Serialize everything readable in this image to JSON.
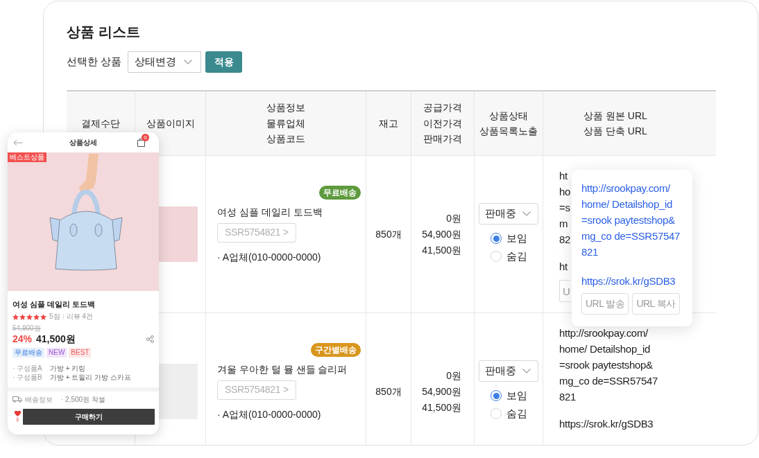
{
  "page": {
    "title": "상품 리스트"
  },
  "bulk_action": {
    "label": "선택한 상품",
    "select": "상태변경",
    "apply_button": "적용"
  },
  "table": {
    "columns": [
      {
        "lines": [
          "결제수단"
        ]
      },
      {
        "lines": [
          "상품이미지"
        ]
      },
      {
        "lines": [
          "상품정보",
          "물류업체",
          "상품코드"
        ]
      },
      {
        "lines": [
          "재고"
        ]
      },
      {
        "lines": [
          "공급가격",
          "이전가격",
          "판매가격"
        ]
      },
      {
        "lines": [
          "상품상태",
          "상품목록노출"
        ]
      },
      {
        "lines": [
          "상품 원본 URL",
          "상품 단축 URL"
        ]
      }
    ],
    "rows": [
      {
        "shipping_badge": {
          "label": "무료배송",
          "color": "#5e9a3e"
        },
        "name": "여성 심플 데일리 토드백",
        "code": "SSR5754821 >",
        "vendor": "· A업체(010-0000-0000)",
        "stock": "850개",
        "prices": [
          "0원",
          "54,900원",
          "41,500원"
        ],
        "status": "판매중",
        "visibility": [
          {
            "label": "보임",
            "selected": true
          },
          {
            "label": "숨김",
            "selected": false
          }
        ],
        "original_url": [
          "ht",
          "ho",
          "=s",
          "m",
          "82"
        ],
        "short_url": "ht",
        "buttons": [
          "U"
        ]
      },
      {
        "shipping_badge": {
          "label": "구간별배송",
          "color": "#d9961d"
        },
        "name": "겨울 우아한 털 뮬 샌들 슬리퍼",
        "code": "SSR5754821 >",
        "vendor": "· A업체(010-0000-0000)",
        "stock": "850개",
        "prices": [
          "0원",
          "54,900원",
          "41,500원"
        ],
        "status": "판매중",
        "visibility": [
          {
            "label": "보임",
            "selected": true
          },
          {
            "label": "숨김",
            "selected": false
          }
        ],
        "original_url": [
          "http://srookpay.com/",
          "home/ Detailshop_id",
          "=srook paytestshop&",
          "mg_co de=SSR57547",
          "821"
        ],
        "short_url": "https://srok.kr/gSDB3"
      }
    ]
  },
  "url_popover": {
    "original_url": [
      "http://srookpay.com/",
      "home/ Detailshop_id",
      "=srook paytestshop&",
      "mg_co de=SSR57547",
      "821"
    ],
    "short_url": "https://srok.kr/gSDB3",
    "buttons": [
      "URL 발송",
      "URL 복사"
    ]
  },
  "phone": {
    "title": "상품상세",
    "cart_count": "0",
    "badge": "베스트상품",
    "product_name": "여성 심플 데일리 토드백",
    "stars": 5,
    "rating": "5점",
    "reviews": "리뷰 4건",
    "original_price": "54,900원",
    "discount": "24%",
    "price": "41,500원",
    "tags": [
      {
        "label": "무료배송",
        "kind": "shipping"
      },
      {
        "label": "NEW",
        "kind": "new"
      },
      {
        "label": "BEST",
        "kind": "best"
      }
    ],
    "details": [
      {
        "label": "· 구성품A",
        "value": "가방 + 키링"
      },
      {
        "label": "· 구성품B",
        "value": "가방 + 트윌리 가방 스카프"
      }
    ],
    "shipping": {
      "label": "배송정보",
      "value": "· 2,500원 착불"
    },
    "likes": "3",
    "buy_button": "구매하기"
  }
}
